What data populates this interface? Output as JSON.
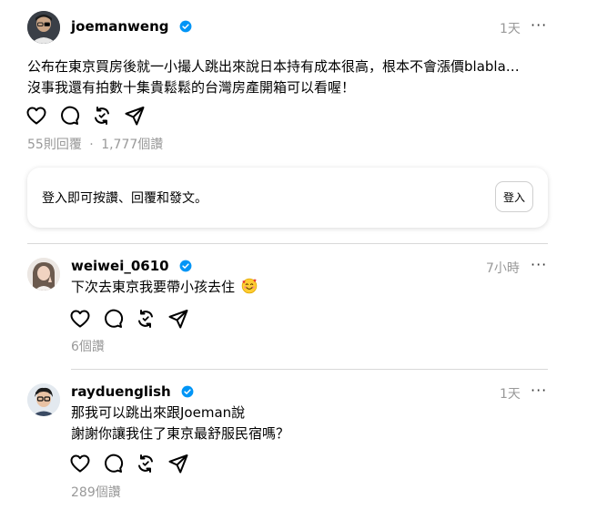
{
  "post": {
    "username": "joemanweng",
    "time": "1天",
    "more": "···",
    "line1": "公布在東京買房後就一小撮人跳出來說日本持有成本很高，根本不會漲價blabla…",
    "line2": "沒事我還有拍數十集貴鬆鬆的台灣房產開箱可以看喔！",
    "replies": "55則回覆",
    "separator": "·",
    "likes": "1,777個讚"
  },
  "login": {
    "prompt": "登入即可按讚、回覆和發文。",
    "button": "登入"
  },
  "replies": [
    {
      "username": "weiwei_0610",
      "time": "7小時",
      "more": "···",
      "text": "下次去東京我要帶小孩去住",
      "likes": "6個讚"
    },
    {
      "username": "rayduenglish",
      "time": "1天",
      "more": "···",
      "line1": "那我可以跳出來跟Joeman說",
      "line2": "謝謝你讓我住了東京最舒服民宿嗎？",
      "likes": "289個讚"
    }
  ],
  "icons": {
    "like": "heart-icon",
    "comment": "comment-icon",
    "repost": "repost-icon",
    "share": "share-icon",
    "verified": "verified-badge-icon",
    "emoji": "smiling-face-with-hearts-emoji"
  },
  "colors": {
    "verified": "#0095f6",
    "muted": "#999999",
    "divider": "#d8d8d8"
  }
}
